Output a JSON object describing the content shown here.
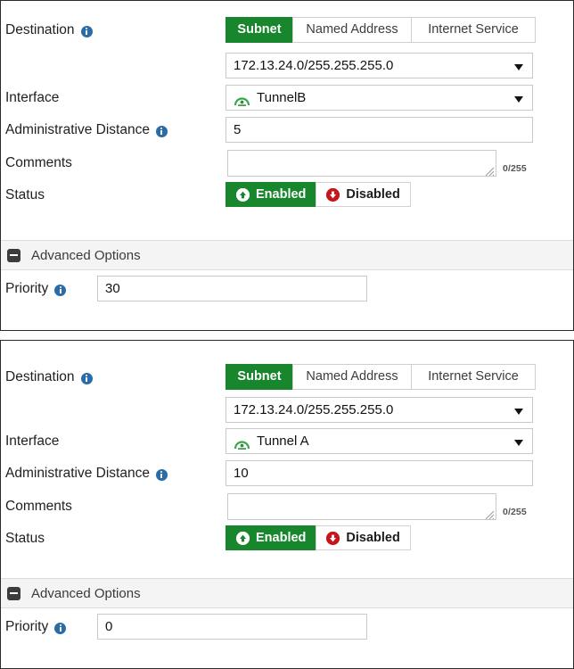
{
  "panels": [
    {
      "destination": {
        "label": "Destination",
        "info_icon": "info-icon",
        "tabs": [
          {
            "label": "Subnet",
            "active": true
          },
          {
            "label": "Named Address",
            "active": false
          },
          {
            "label": "Internet Service",
            "active": false
          }
        ],
        "subnet_value": "172.13.24.0/255.255.255.0",
        "caret_icon": "chevron-down-icon"
      },
      "interface": {
        "label": "Interface",
        "value": "TunnelB",
        "icon": "tunnel-interface-icon",
        "caret_icon": "chevron-down-icon"
      },
      "administrative_distance": {
        "label": "Administrative Distance",
        "info_icon": "info-icon",
        "value": "5"
      },
      "comments": {
        "label": "Comments",
        "value": "",
        "counter": "0/255",
        "resize_icon": "resize-grip-icon"
      },
      "status": {
        "label": "Status",
        "enabled_label": "Enabled",
        "disabled_label": "Disabled",
        "enabled_icon": "arrow-up-circle-icon",
        "disabled_icon": "arrow-down-circle-icon",
        "selected": "Enabled"
      },
      "advanced": {
        "title": "Advanced Options",
        "collapse_icon": "minus-square-icon",
        "priority_label": "Priority",
        "priority_info_icon": "info-icon",
        "priority_value": "30"
      }
    },
    {
      "destination": {
        "label": "Destination",
        "info_icon": "info-icon",
        "tabs": [
          {
            "label": "Subnet",
            "active": true
          },
          {
            "label": "Named Address",
            "active": false
          },
          {
            "label": "Internet Service",
            "active": false
          }
        ],
        "subnet_value": "172.13.24.0/255.255.255.0",
        "caret_icon": "chevron-down-icon"
      },
      "interface": {
        "label": "Interface",
        "value": "Tunnel A",
        "icon": "tunnel-interface-icon",
        "caret_icon": "chevron-down-icon"
      },
      "administrative_distance": {
        "label": "Administrative Distance",
        "info_icon": "info-icon",
        "value": "10"
      },
      "comments": {
        "label": "Comments",
        "value": "",
        "counter": "0/255",
        "resize_icon": "resize-grip-icon"
      },
      "status": {
        "label": "Status",
        "enabled_label": "Enabled",
        "disabled_label": "Disabled",
        "enabled_icon": "arrow-up-circle-icon",
        "disabled_icon": "arrow-down-circle-icon",
        "selected": "Enabled"
      },
      "advanced": {
        "title": "Advanced Options",
        "collapse_icon": "minus-square-icon",
        "priority_label": "Priority",
        "priority_info_icon": "info-icon",
        "priority_value": "0"
      }
    }
  ],
  "colors": {
    "accent_green": "#18862c",
    "danger_red": "#c8151b",
    "info_blue": "#2a6ca8",
    "border_gray": "#c9c9c9",
    "header_gray": "#f4f4f4"
  }
}
